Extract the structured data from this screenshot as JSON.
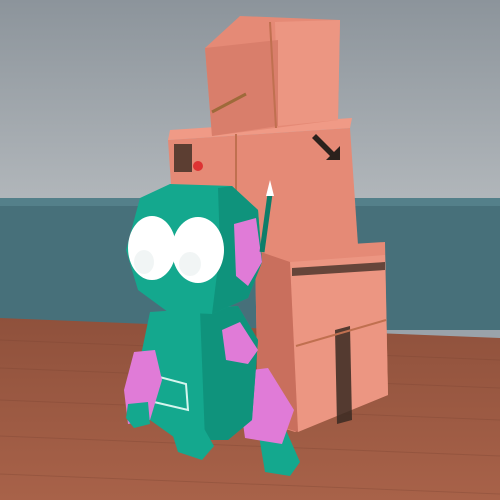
{
  "scene": {
    "sky_color": "#a3a9ae",
    "sea_color": "#47707a",
    "floor_color": "#9a5a43",
    "box_color": "#e58a76",
    "box_shade": "#c96f5d",
    "robot_body": "#14a88e",
    "robot_dark": "#0e7d69",
    "robot_accent": "#e07bd7",
    "eye_color": "#ffffff"
  }
}
